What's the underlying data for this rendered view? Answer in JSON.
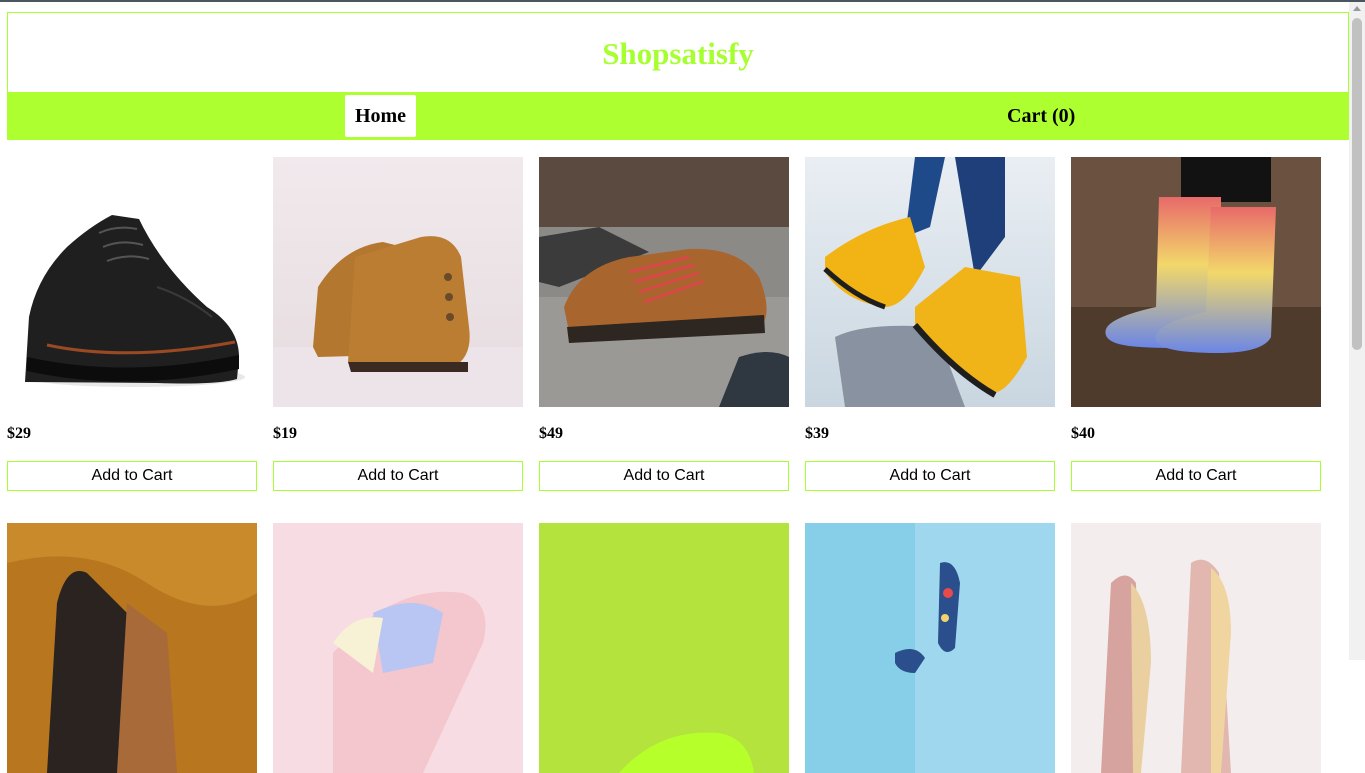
{
  "brand": "Shopsatisfy",
  "nav": {
    "home": "Home",
    "cart": "Cart (0)"
  },
  "theme": {
    "accent": "#adff2f"
  },
  "add_to_cart_label": "Add to Cart",
  "products": [
    {
      "image": "black-leather-brogue-shoe",
      "price": "$29"
    },
    {
      "image": "tan-ankle-boots",
      "price": "$19"
    },
    {
      "image": "brown-hiking-boots-red-laces",
      "price": "$49"
    },
    {
      "image": "yellow-lace-up-boots",
      "price": "$39"
    },
    {
      "image": "gradient-rain-boots",
      "price": "$40"
    },
    {
      "image": "sneaker-on-mustard-fabric",
      "price": null
    },
    {
      "image": "pastel-sneakers",
      "price": null
    },
    {
      "image": "neon-green-sneaker",
      "price": null
    },
    {
      "image": "floral-shoe-blue-background",
      "price": null
    },
    {
      "image": "glitter-heels",
      "price": null
    }
  ]
}
